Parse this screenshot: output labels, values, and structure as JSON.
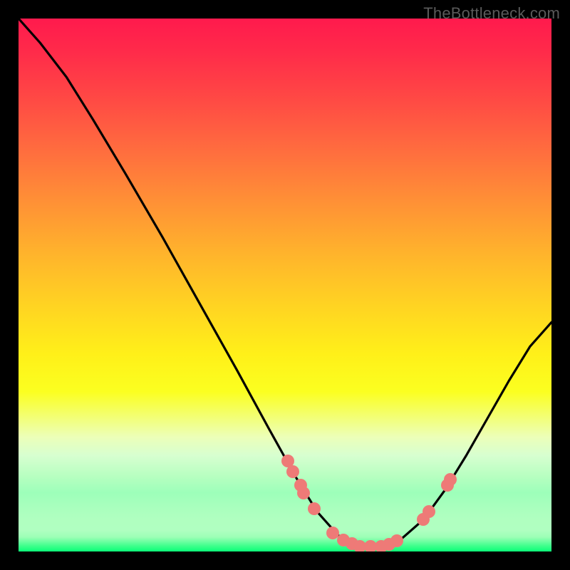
{
  "watermark": "TheBottleneck.com",
  "colors": {
    "dot": "#ee7a77",
    "curve": "#000000"
  },
  "chart_data": {
    "type": "line",
    "title": "",
    "xlabel": "",
    "ylabel": "",
    "xlim": [
      0,
      100
    ],
    "ylim": [
      0,
      100
    ],
    "grid": false,
    "legend": false,
    "curve": [
      {
        "x": 0.0,
        "y": 100.0
      },
      {
        "x": 4.0,
        "y": 95.5
      },
      {
        "x": 9.0,
        "y": 89.0
      },
      {
        "x": 14.0,
        "y": 81.0
      },
      {
        "x": 20.0,
        "y": 71.0
      },
      {
        "x": 27.0,
        "y": 59.0
      },
      {
        "x": 34.0,
        "y": 46.5
      },
      {
        "x": 41.0,
        "y": 34.0
      },
      {
        "x": 47.0,
        "y": 23.0
      },
      {
        "x": 52.0,
        "y": 14.0
      },
      {
        "x": 56.0,
        "y": 7.5
      },
      {
        "x": 60.0,
        "y": 3.0
      },
      {
        "x": 64.0,
        "y": 1.0
      },
      {
        "x": 68.0,
        "y": 1.0
      },
      {
        "x": 72.0,
        "y": 2.5
      },
      {
        "x": 76.0,
        "y": 6.0
      },
      {
        "x": 80.0,
        "y": 11.5
      },
      {
        "x": 84.0,
        "y": 18.0
      },
      {
        "x": 88.0,
        "y": 25.0
      },
      {
        "x": 92.0,
        "y": 32.0
      },
      {
        "x": 96.0,
        "y": 38.5
      },
      {
        "x": 100.0,
        "y": 43.0
      }
    ],
    "dots": [
      {
        "x": 50.5,
        "y": 17.0
      },
      {
        "x": 51.5,
        "y": 15.0
      },
      {
        "x": 53.0,
        "y": 12.5
      },
      {
        "x": 53.5,
        "y": 11.0
      },
      {
        "x": 55.5,
        "y": 8.0
      },
      {
        "x": 59.0,
        "y": 3.5
      },
      {
        "x": 61.0,
        "y": 2.2
      },
      {
        "x": 62.5,
        "y": 1.5
      },
      {
        "x": 64.0,
        "y": 1.0
      },
      {
        "x": 66.0,
        "y": 1.0
      },
      {
        "x": 68.0,
        "y": 1.0
      },
      {
        "x": 69.5,
        "y": 1.3
      },
      {
        "x": 71.0,
        "y": 2.0
      },
      {
        "x": 76.0,
        "y": 6.0
      },
      {
        "x": 77.0,
        "y": 7.5
      },
      {
        "x": 80.5,
        "y": 12.5
      },
      {
        "x": 81.0,
        "y": 13.5
      }
    ]
  }
}
